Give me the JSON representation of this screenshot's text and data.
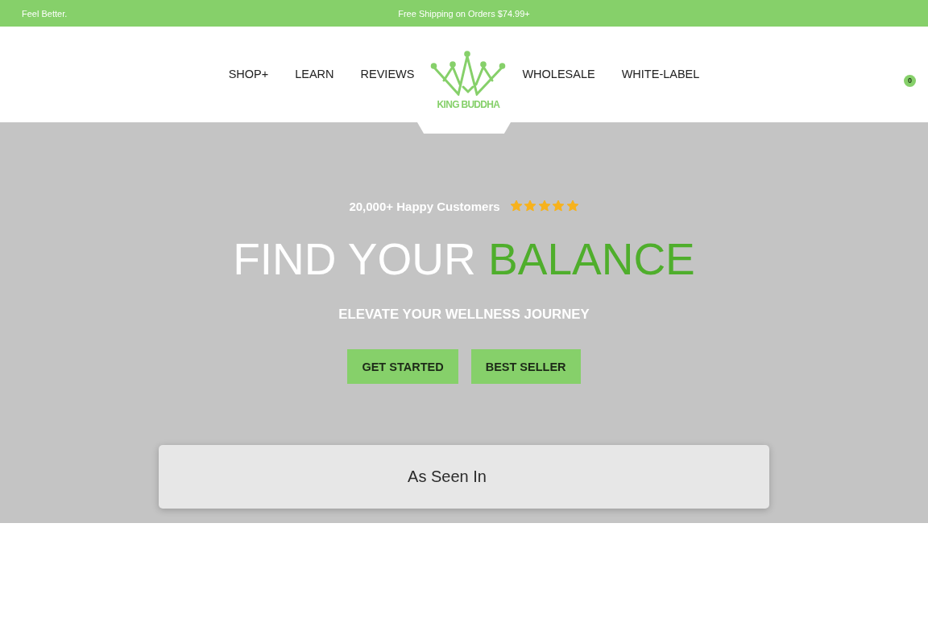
{
  "announcement_bar": {
    "left_text": "Feel Better.",
    "center_text": "Free Shipping on Orders $74.99+"
  },
  "header": {
    "nav_left": [
      "SHOP+",
      "LEARN",
      "REVIEWS"
    ],
    "logo": {
      "text": "KING BUDDHA"
    },
    "nav_right": [
      "WHOLESALE",
      "WHITE-LABEL"
    ],
    "cart_count": "0"
  },
  "hero": {
    "rating_text": "20,000+ Happy Customers",
    "stars": 5,
    "headline": [
      {
        "text": "FIND YOUR",
        "accent": false
      },
      {
        "text": "BALANCE",
        "accent": true
      }
    ],
    "subheadline": "ELEVATE YOUR WELLNESS JOURNEY",
    "buttons": [
      {
        "label": "GET STARTED"
      },
      {
        "label": "BEST SELLER"
      }
    ],
    "as_seen_in": {
      "title": "As Seen In"
    }
  }
}
